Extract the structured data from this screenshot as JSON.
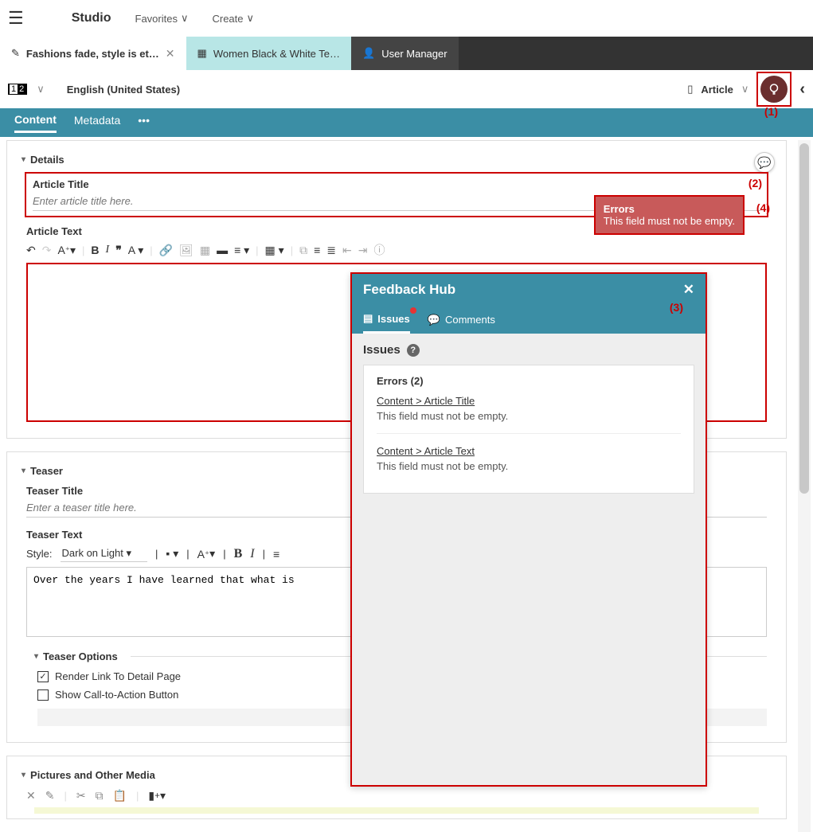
{
  "top": {
    "brand": "Studio",
    "menu": [
      "Favorites",
      "Create"
    ]
  },
  "tabs": [
    {
      "label": "Fashions fade, style is et…",
      "active": true,
      "close": true,
      "type": "edit"
    },
    {
      "label": "Women Black & White Te…",
      "type": "doc"
    },
    {
      "label": "User Manager",
      "type": "user"
    }
  ],
  "secondbar": {
    "pages": [
      "1",
      "2"
    ],
    "locale": "English (United States)",
    "doctype": "Article"
  },
  "contentTabs": [
    "Content",
    "Metadata"
  ],
  "details": {
    "section": "Details",
    "titleLabel": "Article Title",
    "titlePlaceholder": "Enter article title here.",
    "textLabel": "Article Text"
  },
  "errorPopup": {
    "header": "Errors",
    "message": "This field must not be empty."
  },
  "annotations": {
    "a1": "(1)",
    "a2": "(2)",
    "a3": "(3)",
    "a4": "(4)"
  },
  "feedback": {
    "title": "Feedback Hub",
    "tabs": [
      "Issues",
      "Comments"
    ],
    "issuesHeader": "Issues",
    "errorsHeader": "Errors (2)",
    "items": [
      {
        "path": "Content > Article Title",
        "msg": "This field must not be empty."
      },
      {
        "path": "Content > Article Text",
        "msg": "This field must not be empty."
      }
    ]
  },
  "teaser": {
    "section": "Teaser",
    "titleLabel": "Teaser Title",
    "titlePlaceholder": "Enter a teaser title here.",
    "textLabel": "Teaser Text",
    "styleLabel": "Style:",
    "styleValue": "Dark on Light",
    "textValue": "Over the years I have learned that what is",
    "optionsLabel": "Teaser Options",
    "opt1": "Render Link To Detail Page",
    "opt2": "Show Call-to-Action Button"
  },
  "media": {
    "section": "Pictures and Other Media"
  }
}
